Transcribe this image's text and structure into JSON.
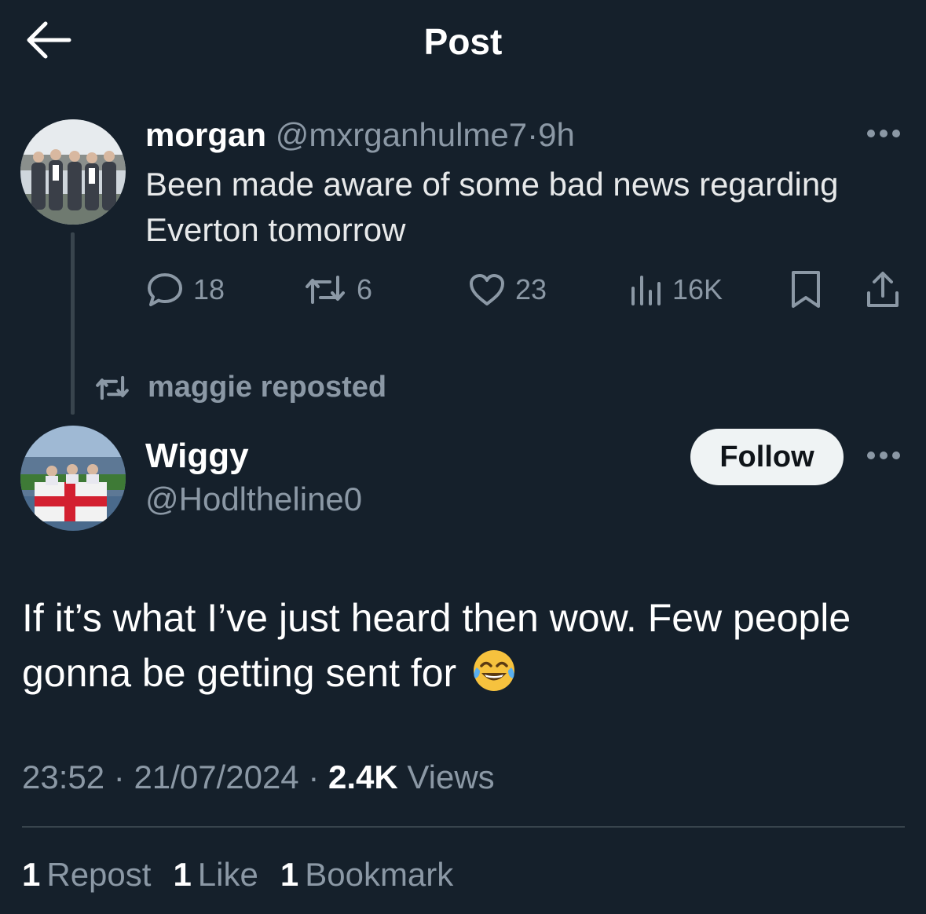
{
  "header": {
    "title": "Post",
    "back_icon": "arrow-left-icon"
  },
  "quoted_post": {
    "author_name": "morgan",
    "author_handle": "@mxrganhulme7",
    "separator": "·",
    "time_ago": "9h",
    "text": "Been made aware of some bad news regarding Everton tomorrow",
    "metrics": {
      "replies": "18",
      "reposts": "6",
      "likes": "23",
      "views": "16K"
    }
  },
  "repost_context": {
    "label": "maggie reposted"
  },
  "post": {
    "author_name": "Wiggy",
    "author_handle": "@Hodltheline0",
    "follow_label": "Follow",
    "text": "If it’s what I’ve just heard then wow. Few people gonna be getting sent for",
    "emoji": "face-with-tears-of-joy",
    "time": "23:52",
    "date": "21/07/2024",
    "views_count": "2.4K",
    "views_label": "Views",
    "separator": "·"
  },
  "engagement": {
    "reposts_count": "1",
    "reposts_label": "Repost",
    "likes_count": "1",
    "likes_label": "Like",
    "bookmarks_count": "1",
    "bookmarks_label": "Bookmark"
  },
  "colors": {
    "background": "#15202b",
    "text_primary": "#e7e9ea",
    "text_muted": "#8b98a5",
    "follow_bg": "#eff3f4"
  }
}
